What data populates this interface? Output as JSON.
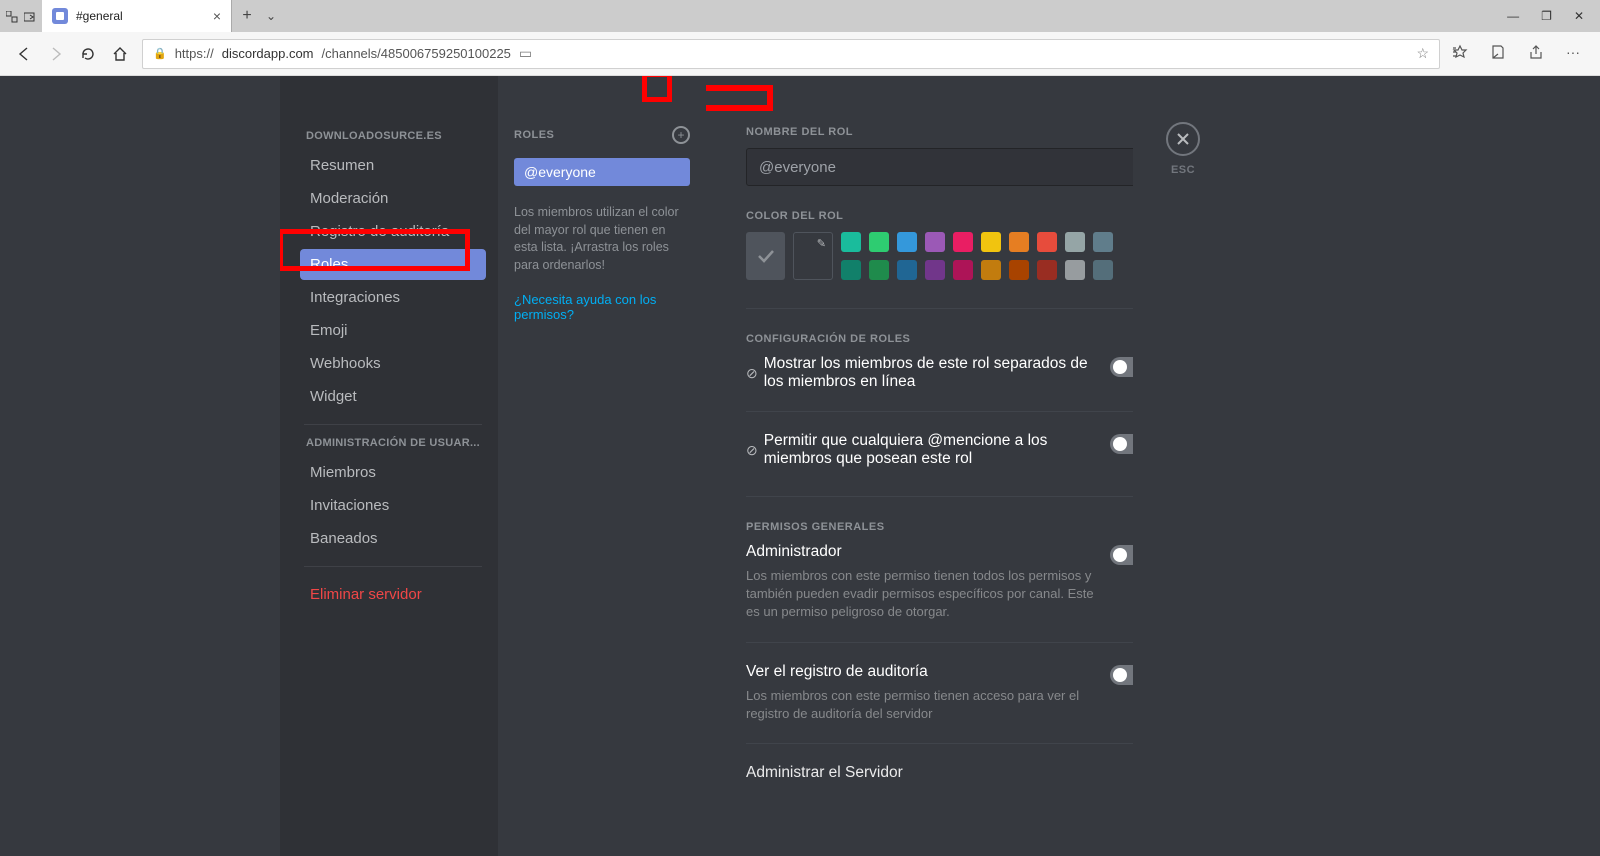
{
  "browser": {
    "tab_title": "#general",
    "url_prefix": "https://",
    "url_host": "discordapp.com",
    "url_path": "/channels/485006759250100225"
  },
  "sidebar": {
    "server_name": "DOWNLOADOSURCE.ES",
    "items": [
      "Resumen",
      "Moderación",
      "Registro de auditoría",
      "Roles",
      "Integraciones",
      "Emoji",
      "Webhooks",
      "Widget"
    ],
    "admin_header": "ADMINISTRACIÓN DE USUAR...",
    "admin_items": [
      "Miembros",
      "Invitaciones",
      "Baneados"
    ],
    "delete": "Eliminar servidor"
  },
  "roles": {
    "header": "ROLES",
    "everyone": "@everyone",
    "help_text": "Los miembros utilizan el color del mayor rol que tienen en esta lista. ¡Arrastra los roles para ordenarlos!",
    "help_link": "¿Necesita ayuda con los permisos?"
  },
  "main": {
    "name_label": "NOMBRE DEL ROL",
    "name_value": "@everyone",
    "color_label": "COLOR DEL ROL",
    "colors_row1": [
      "#1abc9c",
      "#2ecc71",
      "#3498db",
      "#9b59b6",
      "#e91e63",
      "#f1c40f",
      "#e67e22",
      "#e74c3c",
      "#95a5a6",
      "#607d8b"
    ],
    "colors_row2": [
      "#11806a",
      "#1f8b4c",
      "#206694",
      "#71368a",
      "#ad1457",
      "#c27c0e",
      "#a84300",
      "#992d22",
      "#979c9f",
      "#546e7a"
    ],
    "config_label": "CONFIGURACIÓN DE ROLES",
    "display_separate": "Mostrar los miembros de este rol separados de los miembros en línea",
    "allow_mention": "Permitir que cualquiera @mencione a los miembros que posean este rol",
    "perms_label": "PERMISOS GENERALES",
    "admin_title": "Administrador",
    "admin_desc": "Los miembros con este permiso tienen todos los permisos y también pueden evadir permisos específicos por canal. Este es un permiso peligroso de otorgar.",
    "audit_title": "Ver el registro de auditoría",
    "audit_desc": "Los miembros con este permiso tienen acceso para ver el registro de auditoría del servidor",
    "manage_server_title": "Administrar el Servidor"
  },
  "close": {
    "esc": "ESC"
  }
}
